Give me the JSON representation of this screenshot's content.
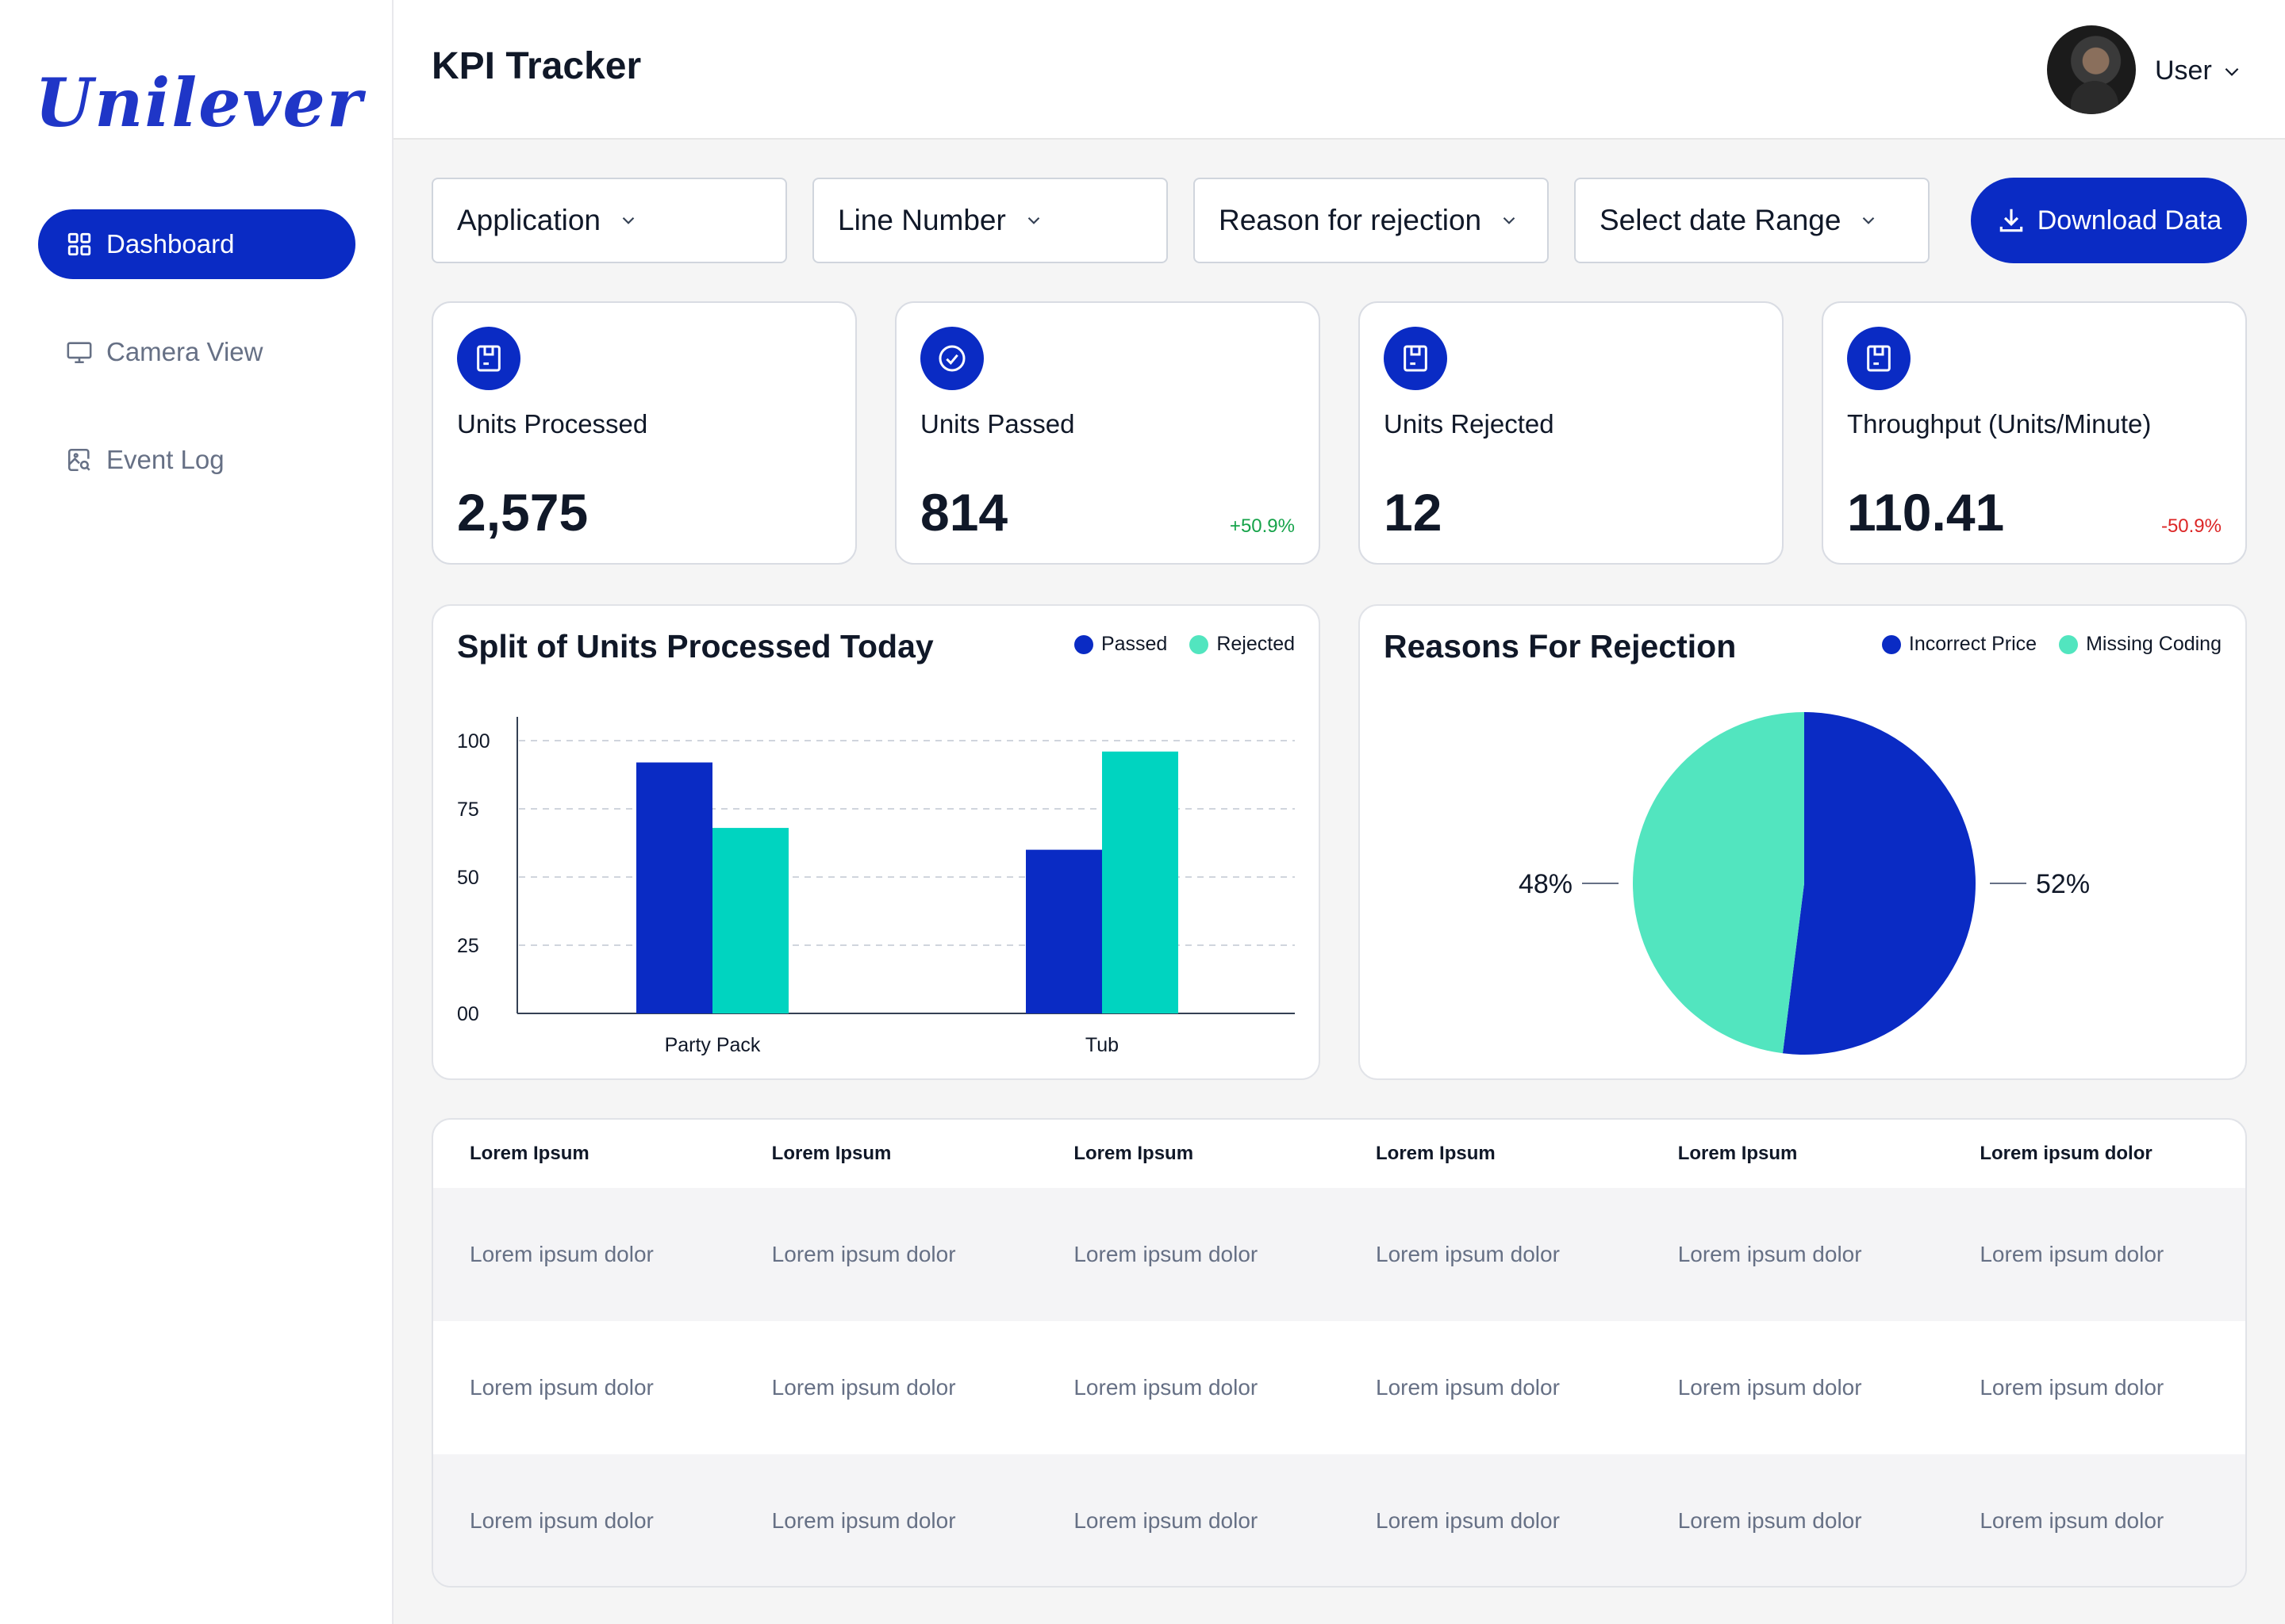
{
  "brand": {
    "logo_text": "Unilever",
    "accent": "#0a2bc4"
  },
  "sidebar": {
    "items": [
      {
        "label": "Dashboard",
        "icon": "grid-icon",
        "active": true
      },
      {
        "label": "Camera View",
        "icon": "monitor-icon",
        "active": false
      },
      {
        "label": "Event Log",
        "icon": "image-search-icon",
        "active": false
      }
    ]
  },
  "header": {
    "title": "KPI Tracker",
    "user": "User"
  },
  "filters": {
    "application": "Application",
    "line_number": "Line Number",
    "reason": "Reason for rejection",
    "date_range": "Select date Range",
    "download": "Download Data"
  },
  "kpis": [
    {
      "label": "Units Processed",
      "value": "2,575",
      "delta": "",
      "delta_color": ""
    },
    {
      "label": "Units Passed",
      "value": "814",
      "delta": "+50.9%",
      "delta_color": "#16a34a"
    },
    {
      "label": "Units Rejected",
      "value": "12",
      "delta": "",
      "delta_color": ""
    },
    {
      "label": "Throughput (Units/Minute)",
      "value": "110.41",
      "delta": "-50.9%",
      "delta_color": "#dc2626"
    }
  ],
  "chart_data": [
    {
      "type": "bar",
      "title": "Split of Units Processed Today",
      "categories": [
        "Party Pack",
        "Tub"
      ],
      "series": [
        {
          "name": "Passed",
          "values": [
            92,
            60
          ],
          "color": "#0a2bc4"
        },
        {
          "name": "Rejected",
          "values": [
            68,
            96
          ],
          "color": "#00d4c0"
        }
      ],
      "y_ticks": [
        "100",
        "75",
        "50",
        "25",
        "00"
      ],
      "ylim": [
        0,
        100
      ],
      "grid": true,
      "legend": "top-right"
    },
    {
      "type": "pie",
      "title": "Reasons For Rejection",
      "labels": [
        "Incorrect Price",
        "Missing Coding"
      ],
      "values": [
        52,
        48
      ],
      "value_labels": [
        "52%",
        "48%"
      ],
      "colors": [
        "#0a2bc4",
        "#52e5bf"
      ],
      "legend": "top-right"
    }
  ],
  "table": {
    "headers": [
      "Lorem Ipsum",
      "Lorem Ipsum",
      "Lorem Ipsum",
      "Lorem Ipsum",
      "Lorem Ipsum",
      "Lorem ipsum dolor"
    ],
    "rows": [
      [
        "Lorem ipsum dolor",
        "Lorem ipsum dolor",
        "Lorem ipsum dolor",
        "Lorem ipsum dolor",
        "Lorem ipsum dolor",
        "Lorem ipsum dolor"
      ],
      [
        "Lorem ipsum dolor",
        "Lorem ipsum dolor",
        "Lorem ipsum dolor",
        "Lorem ipsum dolor",
        "Lorem ipsum dolor",
        "Lorem ipsum dolor"
      ],
      [
        "Lorem ipsum dolor",
        "Lorem ipsum dolor",
        "Lorem ipsum dolor",
        "Lorem ipsum dolor",
        "Lorem ipsum dolor",
        "Lorem ipsum dolor"
      ]
    ]
  }
}
